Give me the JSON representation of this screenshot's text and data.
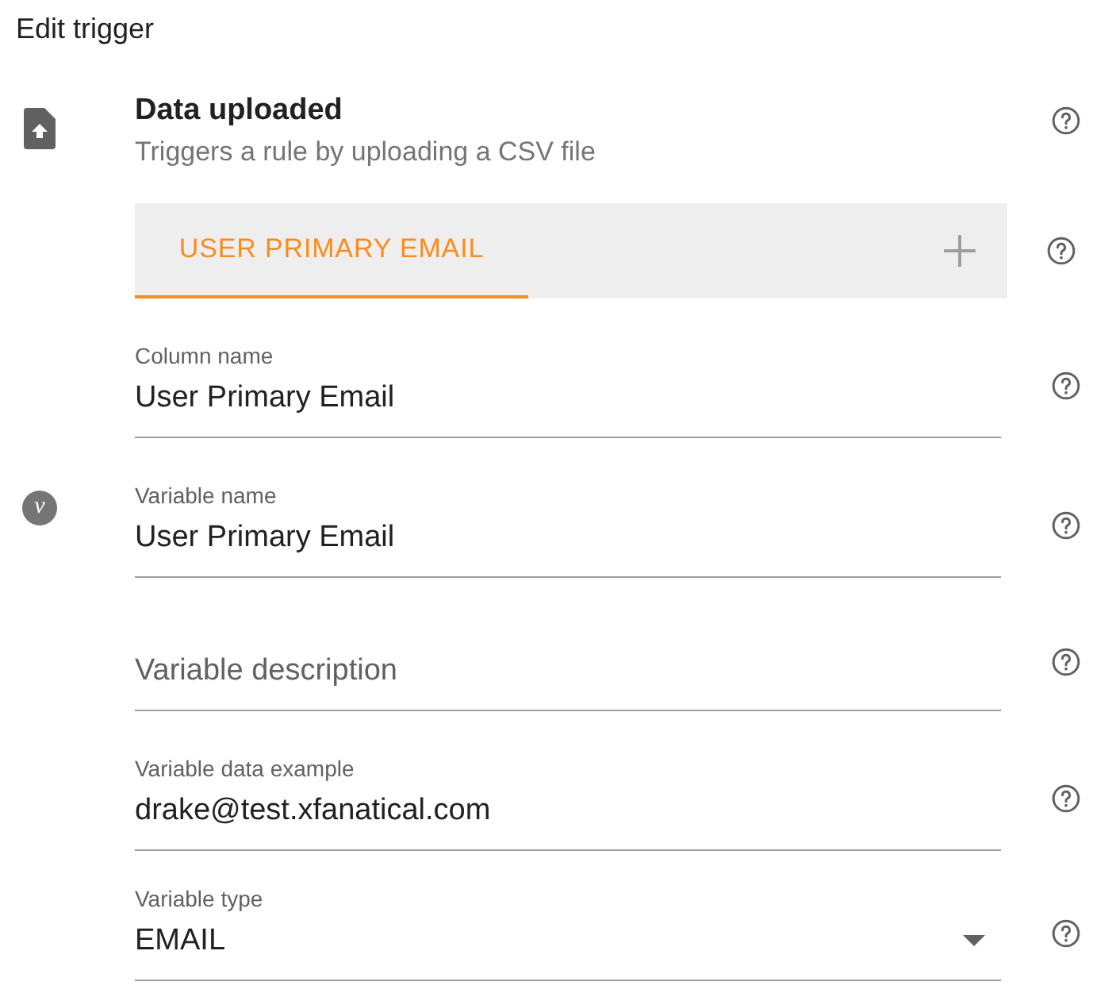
{
  "title": "Edit trigger",
  "trigger": {
    "name": "Data uploaded",
    "description": "Triggers a rule by uploading a CSV file"
  },
  "tabs": [
    {
      "label": "USER PRIMARY EMAIL",
      "selected": true
    }
  ],
  "variable_badge": "v",
  "fields": [
    {
      "kind": "text",
      "label": "Column name",
      "value": "User Primary Email"
    },
    {
      "kind": "text",
      "label": "Variable name",
      "value": "User Primary Email",
      "badge": true
    },
    {
      "kind": "text",
      "placeholder": "Variable description"
    },
    {
      "kind": "text",
      "label": "Variable data example",
      "value": "drake@test.xfanatical.com"
    },
    {
      "kind": "select",
      "label": "Variable type",
      "value": "EMAIL"
    }
  ]
}
